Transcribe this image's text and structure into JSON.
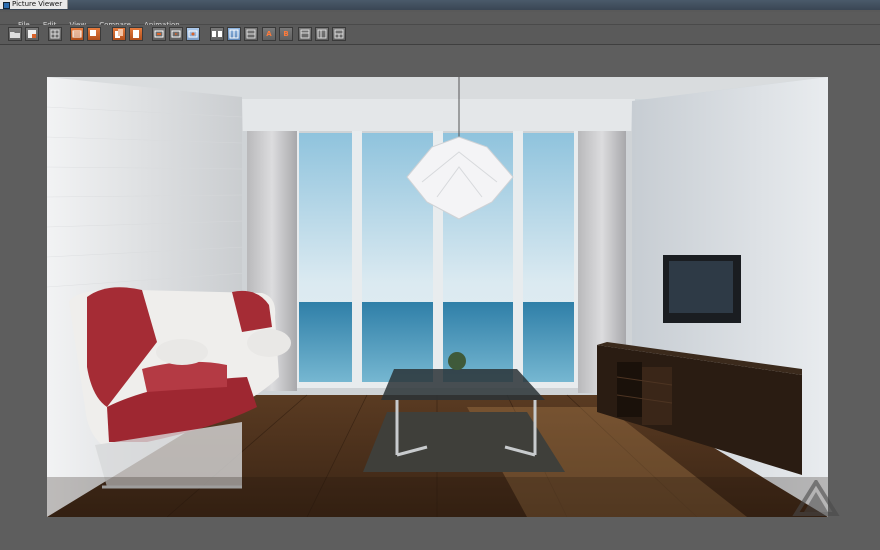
{
  "window": {
    "title": "Picture Viewer"
  },
  "menu": {
    "items": [
      "File",
      "Edit",
      "View",
      "Compare",
      "Animation"
    ]
  },
  "toolbar": {
    "buttons": [
      {
        "icon": "open-folder-icon"
      },
      {
        "icon": "save-icon"
      },
      {
        "icon": "grid-icon"
      },
      {
        "icon": "film-strip-icon"
      },
      {
        "icon": "render-region-icon"
      },
      {
        "icon": "copy-icon"
      },
      {
        "icon": "export-icon"
      },
      {
        "icon": "frame-icon"
      },
      {
        "icon": "frame-play-icon"
      },
      {
        "icon": "frame-loop-icon"
      },
      {
        "icon": "compare-ab-icon"
      },
      {
        "icon": "split-view-icon"
      },
      {
        "icon": "split-swap-icon"
      },
      {
        "icon": "set-a-icon",
        "label": "A"
      },
      {
        "icon": "set-b-icon",
        "label": "B"
      },
      {
        "icon": "layout-1-icon"
      },
      {
        "icon": "layout-2-icon"
      },
      {
        "icon": "layout-3-icon"
      }
    ],
    "accent_orange": "#d9622a",
    "accent_blue": "#7ea7d6"
  },
  "render_image": {
    "subject": "living-room-interior-render"
  }
}
